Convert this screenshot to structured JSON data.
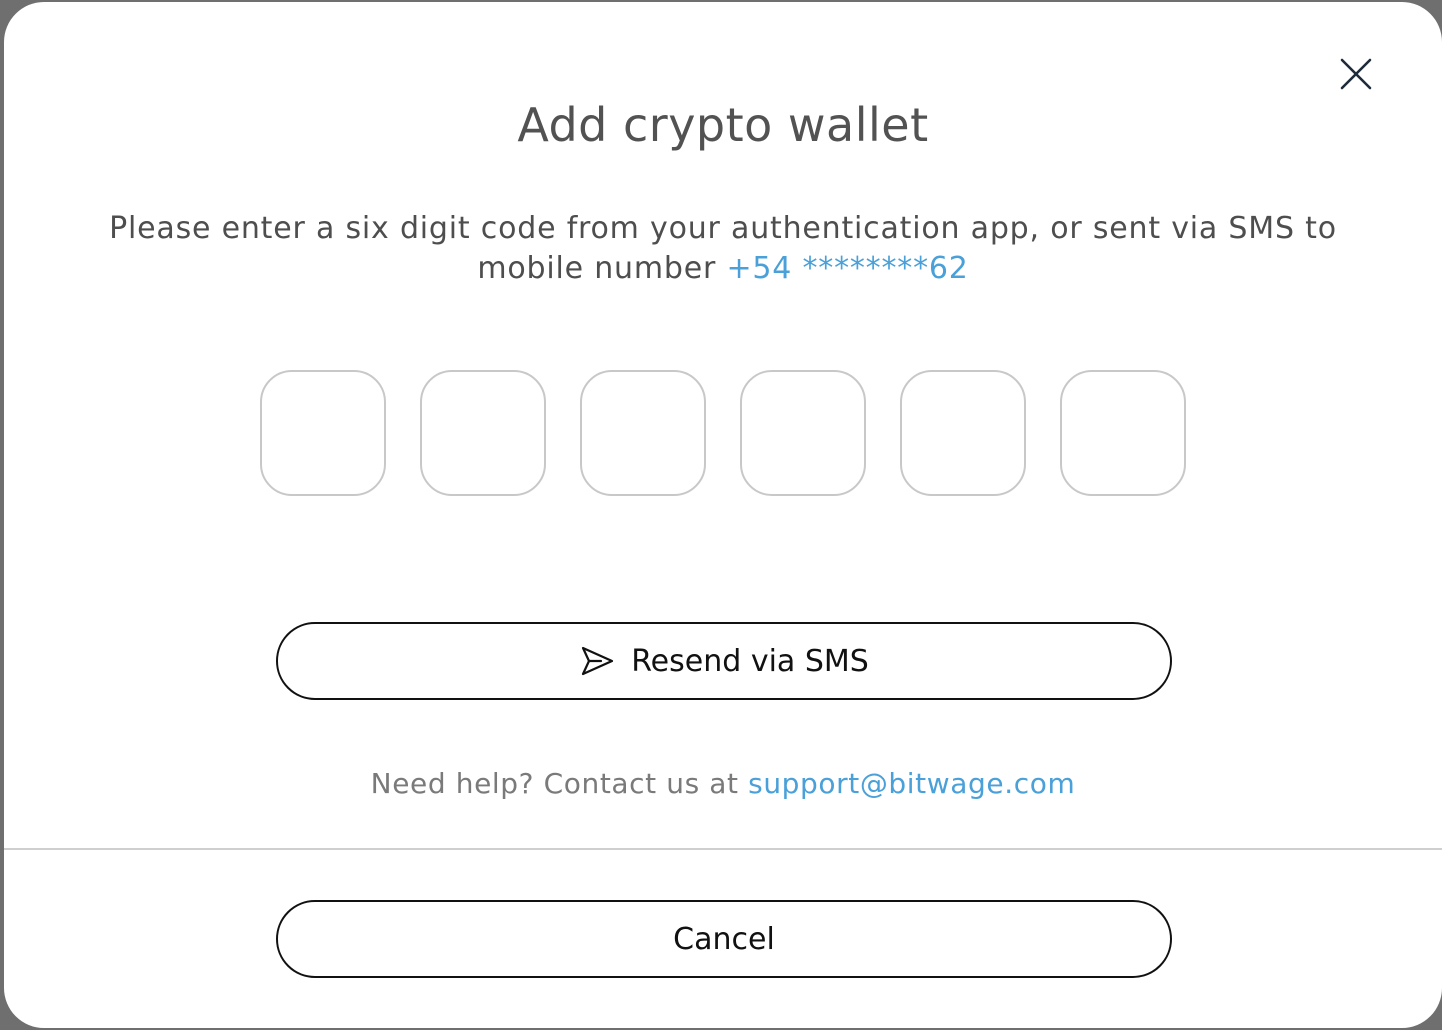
{
  "modal": {
    "title": "Add crypto wallet",
    "instruction_text": "Please enter a six digit code from your authentication app, or sent via SMS to mobile number ",
    "phone_number": "+54 ********62",
    "code_boxes": [
      "",
      "",
      "",
      "",
      "",
      ""
    ],
    "resend_label": "Resend via SMS",
    "help_text": "Need help? Contact us at ",
    "help_email": "support@bitwage.com",
    "cancel_label": "Cancel",
    "icons": {
      "close": "close-icon",
      "send": "send-icon"
    },
    "colors": {
      "link": "#4aa0d8",
      "title": "#525252",
      "border": "#111111",
      "code_box_border": "#c8c8c8"
    }
  }
}
